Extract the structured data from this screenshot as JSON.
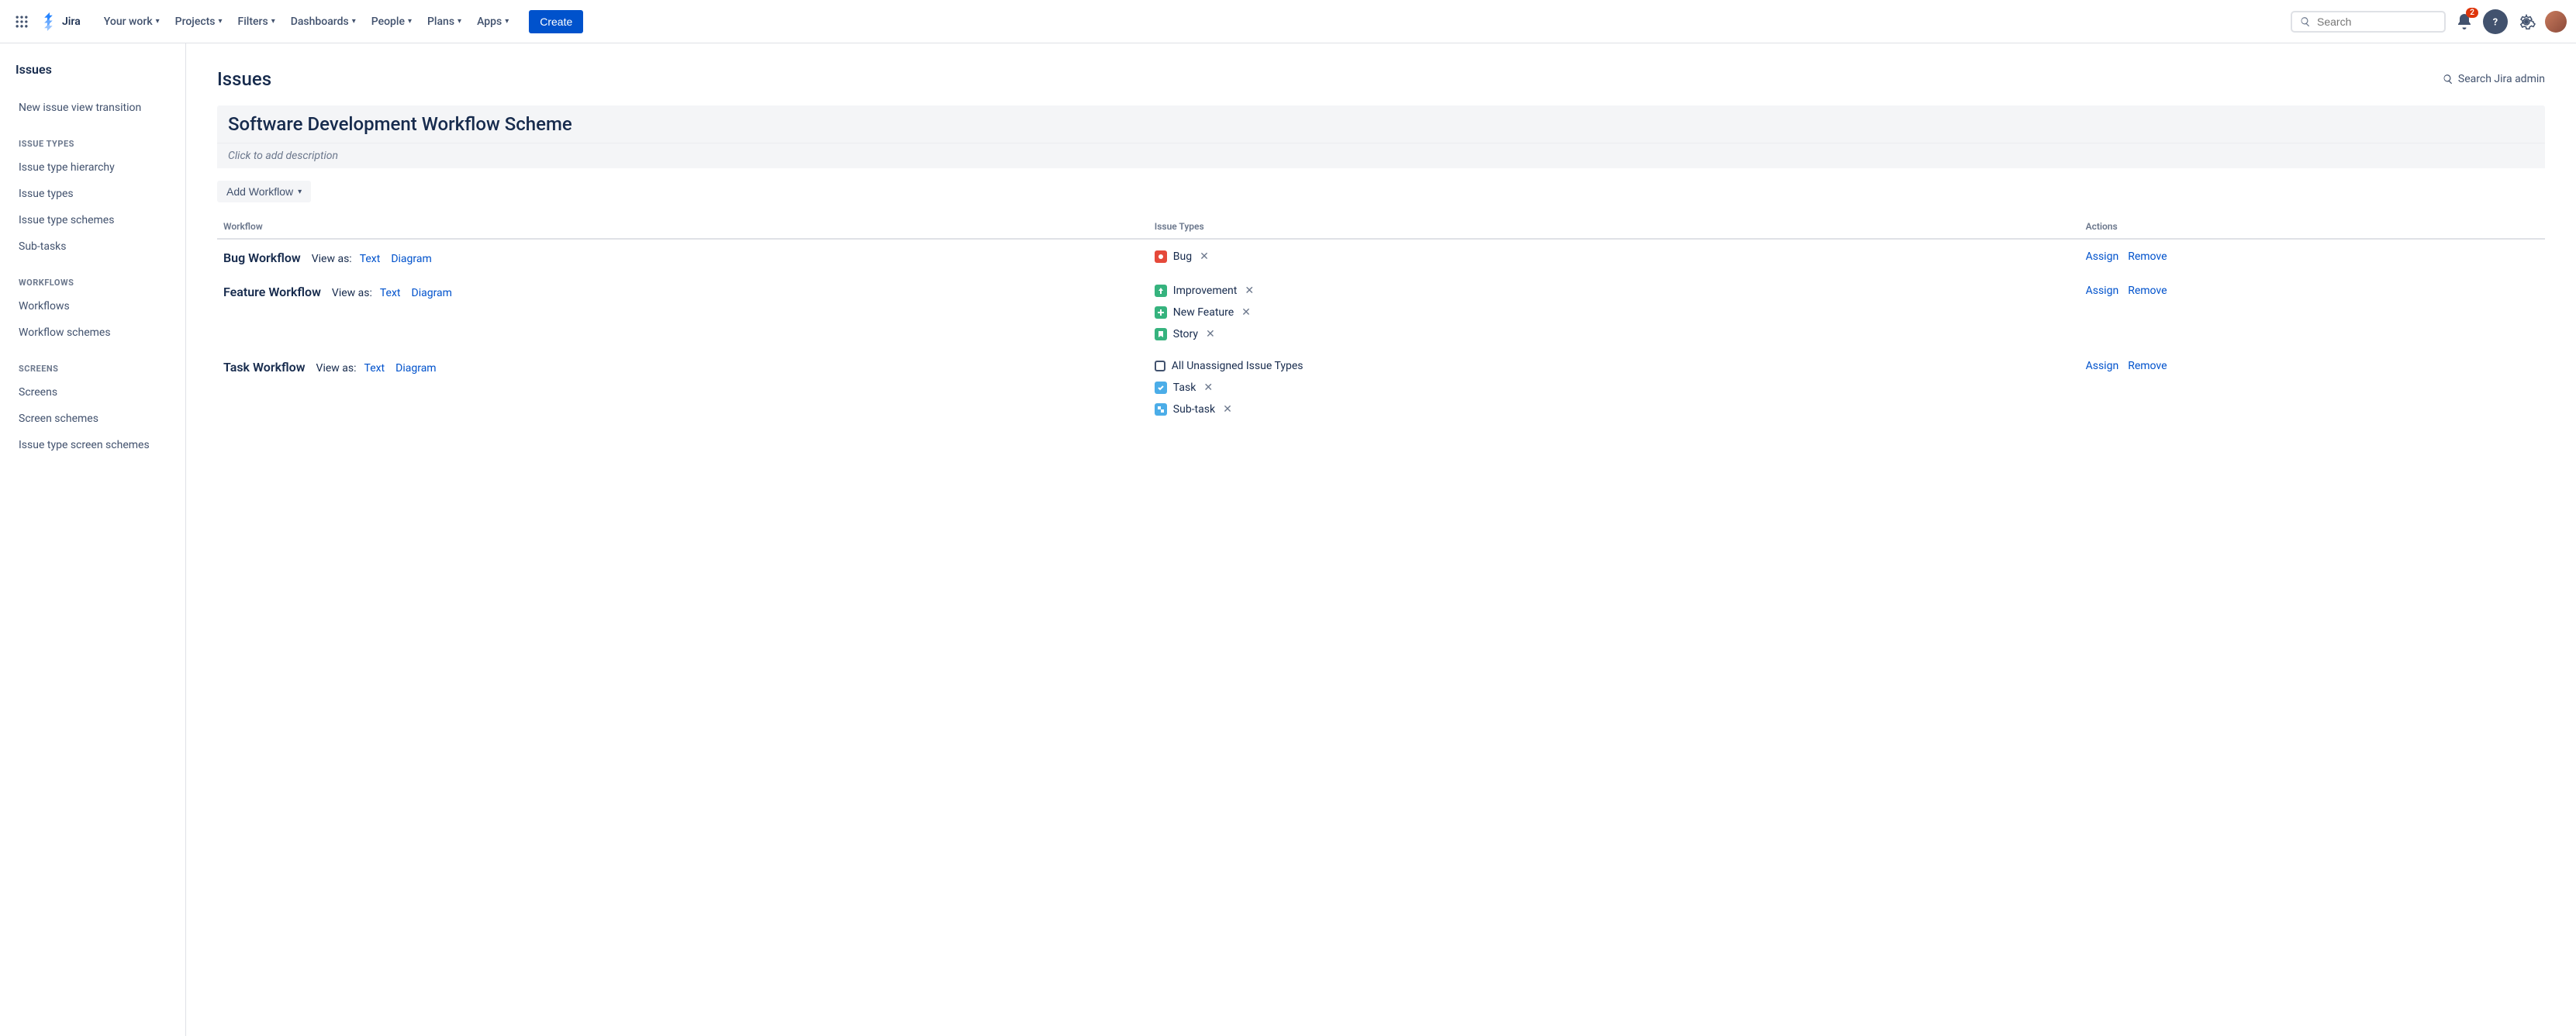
{
  "topnav": {
    "product": "Jira",
    "items": [
      "Your work",
      "Projects",
      "Filters",
      "Dashboards",
      "People",
      "Plans",
      "Apps"
    ],
    "create": "Create",
    "search_placeholder": "Search",
    "notification_count": "2"
  },
  "sidebar": {
    "title": "Issues",
    "top_links": [
      "New issue view transition"
    ],
    "groups": [
      {
        "heading": "ISSUE TYPES",
        "links": [
          "Issue type hierarchy",
          "Issue types",
          "Issue type schemes",
          "Sub-tasks"
        ]
      },
      {
        "heading": "WORKFLOWS",
        "links": [
          "Workflows",
          "Workflow schemes"
        ]
      },
      {
        "heading": "SCREENS",
        "links": [
          "Screens",
          "Screen schemes",
          "Issue type screen schemes"
        ]
      }
    ]
  },
  "main": {
    "page_title": "Issues",
    "admin_search": "Search Jira admin",
    "scheme_title": "Software Development Workflow Scheme",
    "scheme_desc": "Click to add description",
    "add_workflow": "Add Workflow",
    "columns": {
      "workflow": "Workflow",
      "issue_types": "Issue Types",
      "actions": "Actions"
    },
    "view_as_label": "View as:",
    "view_text": "Text",
    "view_diagram": "Diagram",
    "assign": "Assign",
    "remove": "Remove",
    "rows": [
      {
        "name": "Bug Workflow",
        "issue_types": [
          {
            "icon": "bug",
            "label": "Bug",
            "removable": true
          }
        ]
      },
      {
        "name": "Feature Workflow",
        "issue_types": [
          {
            "icon": "improve",
            "label": "Improvement",
            "removable": true
          },
          {
            "icon": "feature",
            "label": "New Feature",
            "removable": true
          },
          {
            "icon": "story",
            "label": "Story",
            "removable": true
          }
        ]
      },
      {
        "name": "Task Workflow",
        "issue_types": [
          {
            "icon": "unassigned",
            "label": "All Unassigned Issue Types",
            "removable": false
          },
          {
            "icon": "task",
            "label": "Task",
            "removable": true
          },
          {
            "icon": "subtask",
            "label": "Sub-task",
            "removable": true
          }
        ]
      }
    ]
  }
}
